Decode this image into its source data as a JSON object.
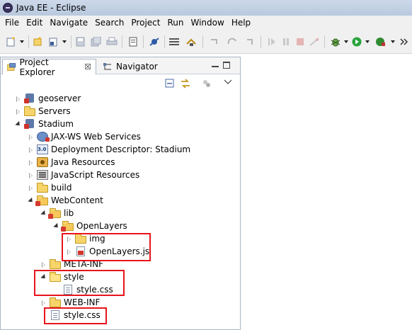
{
  "window": {
    "title": "Java EE - Eclipse"
  },
  "menu": [
    "File",
    "Edit",
    "Navigate",
    "Search",
    "Project",
    "Run",
    "Window",
    "Help"
  ],
  "tabs": {
    "project_explorer": "Project Explorer",
    "navigator": "Navigator",
    "close_glyph": "☒"
  },
  "tree": [
    {
      "label": "geoserver",
      "icon": "project-icon",
      "state": "closed"
    },
    {
      "label": "Servers",
      "icon": "folder-icon",
      "state": "closed"
    },
    {
      "label": "Stadium",
      "icon": "project-icon",
      "state": "open"
    },
    {
      "label": "JAX-WS Web Services",
      "icon": "web-services-icon",
      "state": "closed"
    },
    {
      "label": "Deployment Descriptor: Stadium",
      "icon": "deployment-descriptor-icon",
      "state": "closed"
    },
    {
      "label": "Java Resources",
      "icon": "java-resources-icon",
      "state": "closed"
    },
    {
      "label": "JavaScript Resources",
      "icon": "javascript-resources-icon",
      "state": "closed"
    },
    {
      "label": "build",
      "icon": "folder-icon",
      "state": "closed"
    },
    {
      "label": "WebContent",
      "icon": "web-folder-icon",
      "state": "open"
    },
    {
      "label": "lib",
      "icon": "web-folder-icon",
      "state": "open"
    },
    {
      "label": "OpenLayers",
      "icon": "web-folder-icon",
      "state": "open"
    },
    {
      "label": "img",
      "icon": "folder-icon",
      "state": "closed"
    },
    {
      "label": "OpenLayers.js",
      "icon": "js-file-icon",
      "state": "closed"
    },
    {
      "label": "META-INF",
      "icon": "folder-icon",
      "state": "closed"
    },
    {
      "label": "style",
      "icon": "folder-icon",
      "state": "open"
    },
    {
      "label": "style.css",
      "icon": "css-file-icon",
      "state": "none"
    },
    {
      "label": "WEB-INF",
      "icon": "folder-icon",
      "state": "closed"
    },
    {
      "label": "style.css",
      "icon": "css-file-icon",
      "state": "none"
    }
  ],
  "colors": {
    "highlight": "#e8141c",
    "title_bar": "#c5d3e8",
    "toolbar": "#f0f0f0"
  }
}
